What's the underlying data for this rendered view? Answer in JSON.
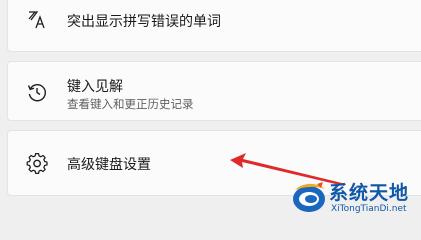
{
  "settings": {
    "items": [
      {
        "icon": "spellcheck-icon",
        "title": "突出显示拼写错误的单词"
      },
      {
        "icon": "history-icon",
        "title": "键入见解",
        "subtitle": "查看键入和更正历史记录"
      },
      {
        "icon": "gear-icon",
        "title": "高级键盘设置"
      }
    ]
  },
  "annotation": {
    "arrow_color": "#e02a2a"
  },
  "watermark": {
    "brand": "系统天地",
    "url": "XiTongTianDi.net",
    "color": "#0f57a8"
  }
}
